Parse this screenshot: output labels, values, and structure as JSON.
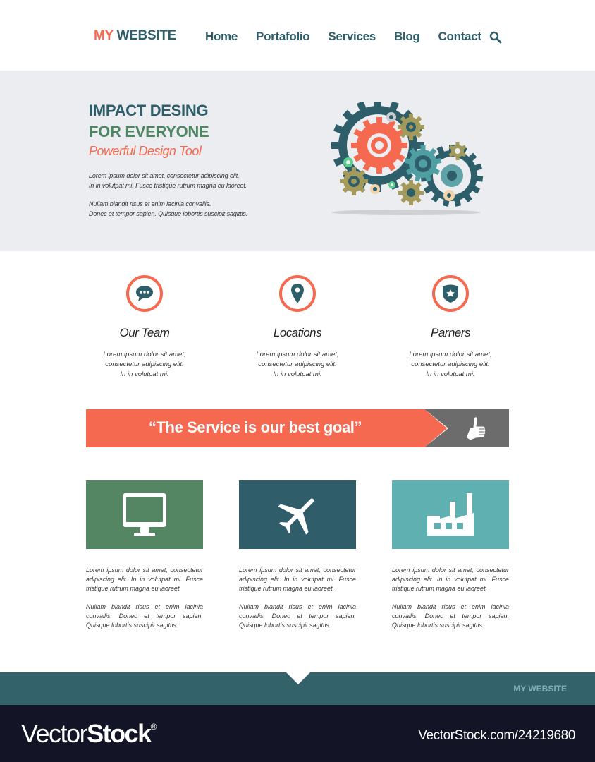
{
  "nav": {
    "logo_my": "MY",
    "logo_website": "WEBSITE",
    "items": [
      {
        "label": "Home"
      },
      {
        "label": "Portafolio"
      },
      {
        "label": "Services"
      },
      {
        "label": "Blog"
      },
      {
        "label": "Contact"
      }
    ],
    "search_icon": "search-icon"
  },
  "hero": {
    "title_line1": "IMPACT DESING",
    "title_line2": "FOR EVERYONE",
    "subtitle": "Powerful Design Tool",
    "paragraph1_line1": "Lorem ipsum dolor sit amet, consectetur adipiscing elit.",
    "paragraph1_line2": "In in volutpat mi. Fusce tristique rutrum magna eu laoreet.",
    "paragraph2_line1": "Nullam blandit risus et enim lacinia convallis.",
    "paragraph2_line2": "Donec et tempor sapien. Quisque lobortis suscipit sagittis.",
    "illustration": "gears-icon"
  },
  "features": [
    {
      "icon": "chat-bubble-icon",
      "title": "Our Team",
      "line1": "Lorem ipsum dolor sit amet,",
      "line2": "consectetur adipiscing elit.",
      "line3": "In in volutpat mi."
    },
    {
      "icon": "map-pin-icon",
      "title": "Locations",
      "line1": "Lorem ipsum dolor sit amet,",
      "line2": "consectetur adipiscing elit.",
      "line3": "In in volutpat mi."
    },
    {
      "icon": "shield-star-icon",
      "title": "Parners",
      "line1": "Lorem ipsum dolor sit amet,",
      "line2": "consectetur adipiscing elit.",
      "line3": "In in volutpat mi."
    }
  ],
  "banner": {
    "quote": "“The Service is our best goal”",
    "icon": "thumbs-up-icon"
  },
  "services": [
    {
      "icon": "monitor-icon",
      "color": "#558663",
      "p1": "Lorem ipsum dolor sit amet, consectetur adipiscing elit. In in volutpat mi. Fusce tristique rutrum magna eu laoreet.",
      "p2": "Nullam blandit risus et enim lacinia convallis. Donec et tempor sapien. Quisque lobortis suscipit sagittis."
    },
    {
      "icon": "airplane-icon",
      "color": "#2f5e6a",
      "p1": "Lorem ipsum dolor sit amet, consectetur adipiscing elit. In in volutpat mi. Fusce tristique rutrum magna eu laoreet.",
      "p2": "Nullam blandit risus et enim lacinia convallis. Donec et tempor sapien. Quisque lobortis suscipit sagittis."
    },
    {
      "icon": "factory-icon",
      "color": "#5fb0b0",
      "p1": "Lorem ipsum dolor sit amet, consectetur adipiscing elit. In in volutpat mi. Fusce tristique rutrum magna eu laoreet.",
      "p2": "Nullam blandit risus et enim lacinia convallis. Donec et tempor sapien. Quisque lobortis suscipit sagittis."
    }
  ],
  "footer": {
    "logo": "MY WEBSITE"
  },
  "watermark": {
    "brand_thin": "Vector",
    "brand_bold": "Stock",
    "registered": "®",
    "id_text": "VectorStock.com/24219680"
  },
  "colors": {
    "accent_red": "#f4694f",
    "teal_dark": "#2d5e69",
    "green": "#4e8663",
    "hero_bg": "#ecedf0",
    "footer_bg": "#33626b",
    "watermark_bg": "#131425"
  }
}
